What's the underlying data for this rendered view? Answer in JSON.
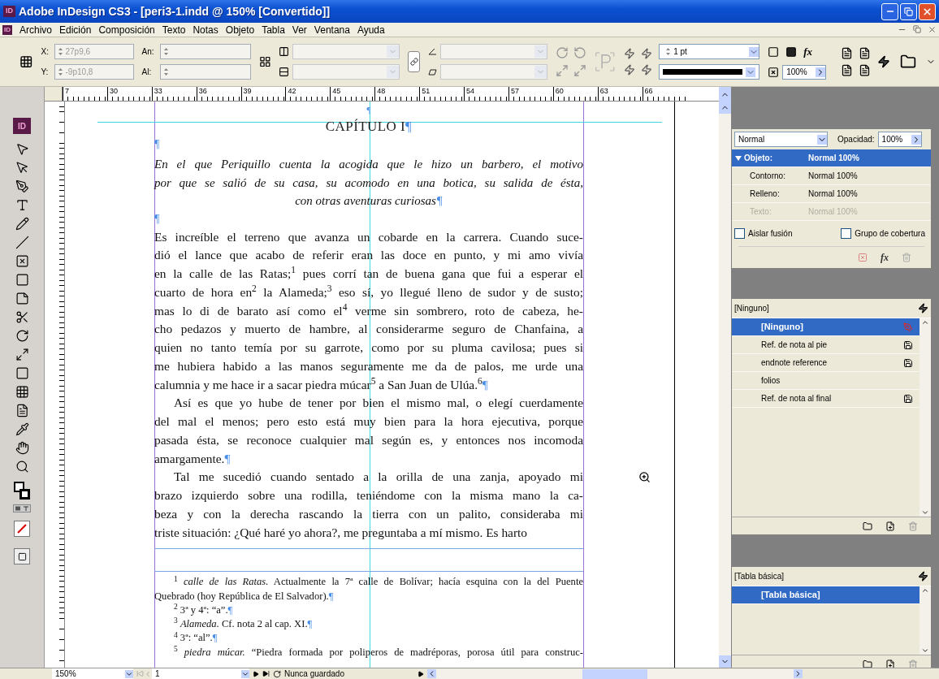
{
  "window": {
    "badge": "ID",
    "title": "Adobe InDesign CS3 - [peri3-1.indd @ 150% [Convertido]]"
  },
  "menu": {
    "badge": "ID",
    "items": [
      "Archivo",
      "Edición",
      "Composición",
      "Texto",
      "Notas",
      "Objeto",
      "Tabla",
      "Ver",
      "Ventana",
      "Ayuda"
    ]
  },
  "control_panel": {
    "x_label": "X:",
    "x_value": "27p9,6",
    "y_label": "Y:",
    "y_value": "-9p10,8",
    "w_label": "An:",
    "h_label": "Al:",
    "stroke_weight": "1 pt",
    "scale": "100%",
    "effects_button": "fx"
  },
  "toolbox": {
    "logo": "ID"
  },
  "ruler": {
    "labels": [
      "7",
      "30",
      "33",
      "36",
      "39",
      "42",
      "45",
      "48",
      "51",
      "54",
      "57",
      "60",
      "63",
      "66"
    ]
  },
  "document": {
    "top_mark": "¶",
    "heading": {
      "text": "CAPÍTULO I",
      "end_mark": "¶"
    },
    "blocks": [
      {
        "kind": "empty",
        "end_mark": "¶"
      },
      {
        "kind": "subtitle",
        "lines": [
          "En el que Periquillo cuenta la acogida que le hizo un barbero, el motivo",
          "por que se salió de su casa, su acomodo en una botica, su salida de ésta,",
          "con otras aventuras curiosas"
        ],
        "end_mark": "¶"
      },
      {
        "kind": "empty",
        "end_mark": "¶"
      },
      {
        "kind": "body",
        "indent": false,
        "lines": [
          "Es increíble el terreno que avanza un cobarde en la carrera. Cuando suce-",
          "dió el lance que acabo de referir eran las doce en punto, y mi amo vivía",
          "en la calle de las Ratas;$^{1}$ pues corrí tan de buena gana que fui a esperar el",
          "cuarto de hora en$^{2}$ la Alameda;$^{3}$ eso sí, yo llegué lleno de sudor y de susto;",
          "mas lo di de barato así como el$^{4}$ verme sin sombrero, roto de cabeza, he-",
          "cho pedazos y muerto de hambre, al considerarme seguro de Chanfaina, a",
          "quien no tanto temía por su garrote, como por su pluma cavilosa; pues si",
          "me hubiera habido a las manos seguramente me da de palos, me urde una",
          "calumnia y me hace ir a sacar piedra múcar$^{5}$ a San Juan de Ulúa.$^{6}$"
        ],
        "end_mark": "¶"
      },
      {
        "kind": "body",
        "indent": true,
        "lines": [
          "Así es que yo hube de tener por bien el mismo mal, o elegí cuerdamente",
          "del mal el menos; pero esto está muy bien para la hora ejecutiva, porque",
          "pasada ésta, se reconoce cualquier mal según es, y entonces nos incomoda",
          "amargamente."
        ],
        "end_mark": "¶"
      },
      {
        "kind": "body",
        "indent": true,
        "lines": [
          "Tal me sucedió cuando sentado a la orilla de una zanja, apoyado mi",
          "brazo izquierdo sobre una rodilla, teniéndome con la misma mano la ca-",
          "beza y con la derecha rascando la tierra con un palito, consideraba mi",
          "triste situación: ¿Qué haré yo ahora?, me preguntaba a mí mismo. Es harto"
        ]
      }
    ],
    "footnotes": [
      {
        "lines": [
          "$^{1}$ *calle de las Ratas.* Actualmente la 7ª calle de Bolívar; hacía esquina con la del Puente",
          "Quebrado (hoy República de El Salvador)."
        ],
        "end_mark": "¶"
      },
      {
        "lines": [
          "$^{2}$ 3ª y 4ª: “a”."
        ],
        "end_mark": "¶"
      },
      {
        "lines": [
          "$^{3}$ *Alameda.* Cf. nota 2 al cap. XI."
        ],
        "end_mark": "¶"
      },
      {
        "lines": [
          "$^{4}$ 3ª: “al”."
        ],
        "end_mark": "¶"
      },
      {
        "lines": [
          "$^{5}$ *piedra múcar.* “Piedra formada por poliperos de madréporas, porosa útil para construc-"
        ],
        "continues": true
      }
    ]
  },
  "effects_panel": {
    "blend_mode": "Normal",
    "opacity_label": "Opacidad:",
    "opacity": "100%",
    "effects_button": "fx",
    "rows": [
      {
        "kind": "group",
        "label": "Objeto:",
        "value": "Normal 100%",
        "selected": true,
        "disabled": false
      },
      {
        "kind": "item",
        "label": "Contorno:",
        "value": "Normal 100%",
        "selected": false,
        "disabled": false
      },
      {
        "kind": "item",
        "label": "Relleno:",
        "value": "Normal 100%",
        "selected": false,
        "disabled": false
      },
      {
        "kind": "item",
        "label": "Texto:",
        "value": "Normal 100%",
        "selected": false,
        "disabled": true
      }
    ],
    "checkboxes": [
      {
        "label": "Aislar fusión",
        "checked": false
      },
      {
        "label": "Grupo de cobertura",
        "checked": false
      }
    ]
  },
  "character_styles": {
    "header": "[Ninguno]",
    "items": [
      {
        "label": "[Ninguno]",
        "selected": true,
        "kind": "locked"
      },
      {
        "label": "Ref. de nota al pie",
        "selected": false,
        "kind": "imported"
      },
      {
        "label": "endnote reference",
        "selected": false,
        "kind": "imported"
      },
      {
        "label": "folios",
        "selected": false,
        "kind": "plain"
      },
      {
        "label": "Ref. de nota al final",
        "selected": false,
        "kind": "imported"
      }
    ]
  },
  "table_styles": {
    "header": "[Tabla básica]",
    "items": [
      {
        "label": "[Tabla básica]",
        "selected": true
      }
    ]
  },
  "status_bar": {
    "zoom": "150%",
    "page": "1",
    "save_state": "Nunca guardado"
  }
}
